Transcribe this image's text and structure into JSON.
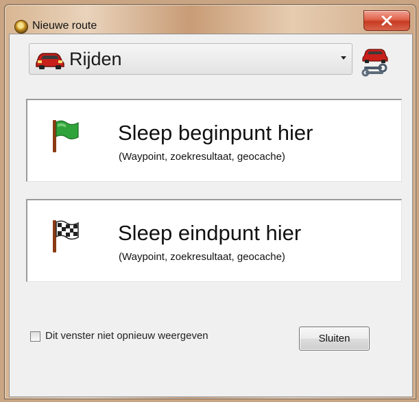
{
  "window": {
    "title": "Nieuwe route"
  },
  "mode_select": {
    "selected": "Rijden",
    "icon": "car-icon",
    "settings_icon": "car-settings-icon"
  },
  "start_zone": {
    "title": "Sleep beginpunt hier",
    "subtitle": "(Waypoint, zoekresultaat, geocache)",
    "icon": "green-flag-icon"
  },
  "end_zone": {
    "title": "Sleep eindpunt hier",
    "subtitle": "(Waypoint, zoekresultaat, geocache)",
    "icon": "checkered-flag-icon"
  },
  "footer": {
    "checkbox_label": "Dit venster niet opnieuw weergeven",
    "checkbox_checked": false,
    "close_button_label": "Sluiten"
  },
  "colors": {
    "flag_green": "#2fa33a",
    "car_red": "#c8201b",
    "close_red": "#d9533b"
  }
}
